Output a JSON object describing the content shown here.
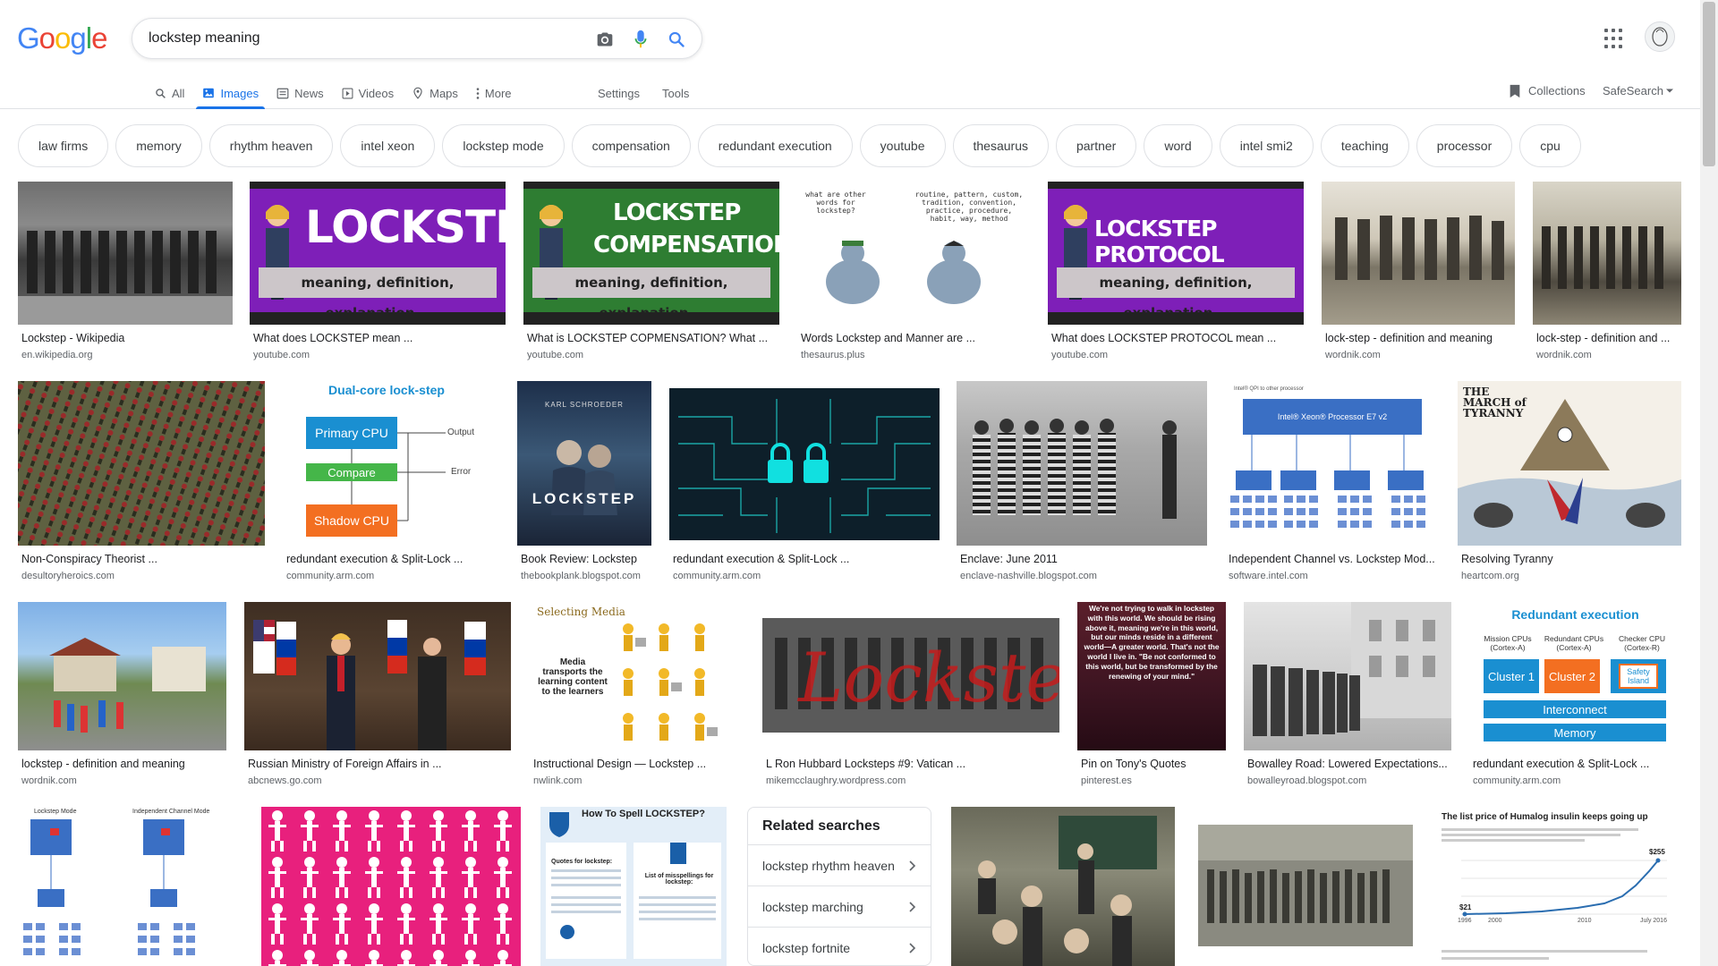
{
  "logo": {
    "letters": [
      "G",
      "o",
      "o",
      "g",
      "l",
      "e"
    ],
    "colors": [
      "#4285F4",
      "#EA4335",
      "#FBBC05",
      "#4285F4",
      "#34A853",
      "#EA4335"
    ]
  },
  "search": {
    "value": "lockstep meaning"
  },
  "tabs": [
    {
      "label": "All",
      "icon": "search-icon"
    },
    {
      "label": "Images",
      "icon": "image-icon",
      "active": true
    },
    {
      "label": "News",
      "icon": "news-icon"
    },
    {
      "label": "Videos",
      "icon": "video-icon"
    },
    {
      "label": "Maps",
      "icon": "map-pin-icon"
    },
    {
      "label": "More",
      "icon": "more-vert-icon"
    }
  ],
  "tools": {
    "settings": "Settings",
    "tools": "Tools",
    "collections": "Collections",
    "safesearch": "SafeSearch"
  },
  "chips": [
    "law firms",
    "memory",
    "rhythm heaven",
    "intel xeon",
    "lockstep mode",
    "compensation",
    "redundant execution",
    "youtube",
    "thesaurus",
    "partner",
    "word",
    "intel smi2",
    "teaching",
    "processor",
    "cpu"
  ],
  "results": [
    {
      "caption": "Lockstep - Wikipedia",
      "source": "en.wikipedia.org"
    },
    {
      "caption": "What does LOCKSTEP mean ...",
      "source": "youtube.com",
      "banner": "LOCKSTEP",
      "sub": "meaning, definition, explanation..."
    },
    {
      "caption": "What is LOCKSTEP COPMENSATION? What ...",
      "source": "youtube.com",
      "banner": "LOCKSTEP",
      "banner2": "COMPENSATION",
      "sub": "meaning, definition, explanation..."
    },
    {
      "caption": "Words Lockstep and Manner are ...",
      "source": "thesaurus.plus",
      "text_left": "what are other words for lockstep?",
      "text_right": "routine, pattern, custom, tradition, convention, practice, procedure, habit, way, method"
    },
    {
      "caption": "What does LOCKSTEP PROTOCOL mean ...",
      "source": "youtube.com",
      "banner": "LOCKSTEP PROTOCOL",
      "sub": "meaning, definition, explanation..."
    },
    {
      "caption": "lock-step - definition and meaning",
      "source": "wordnik.com"
    },
    {
      "caption": "lock-step - definition and ...",
      "source": "wordnik.com"
    },
    {
      "caption": "Non-Conspiracy Theorist ...",
      "source": "desultoryheroics.com"
    },
    {
      "caption": "redundant execution & Split-Lock ...",
      "source": "community.arm.com",
      "diagram_title": "Dual-core lock-step",
      "boxes": [
        "Primary CPU",
        "Compare",
        "Shadow CPU"
      ],
      "labels": [
        "Output",
        "Error"
      ]
    },
    {
      "caption": "Book Review: Lockstep",
      "source": "thebookplank.blogspot.com",
      "author": "KARL SCHROEDER",
      "book_title": "LOCKSTEP"
    },
    {
      "caption": "redundant execution & Split-Lock ...",
      "source": "community.arm.com"
    },
    {
      "caption": "Enclave: June 2011",
      "source": "enclave-nashville.blogspot.com"
    },
    {
      "caption": "Independent Channel vs. Lockstep Mod...",
      "source": "software.intel.com",
      "chip_label": "Intel® Xeon® Processor E7 v2"
    },
    {
      "caption": "Resolving Tyranny",
      "source": "heartcom.org",
      "cartoon_title": "THE MARCH of TYRANNY"
    },
    {
      "caption": "lockstep - definition and meaning",
      "source": "wordnik.com"
    },
    {
      "caption": "Russian Ministry of Foreign Affairs in ...",
      "source": "abcnews.go.com"
    },
    {
      "caption": "Instructional Design — Lockstep ...",
      "source": "nwlink.com",
      "media_title": "Selecting Media",
      "media_text": "Media transports the learning content to the learners"
    },
    {
      "caption": "L Ron Hubbard Locksteps #9: Vatican ...",
      "source": "mikemcclaughry.wordpress.com",
      "overlay": "Lockstep"
    },
    {
      "caption": "Pin on Tony's Quotes",
      "source": "pinterest.es",
      "quote": "We're not trying to walk in lockstep with this world. We should be rising above it, meaning we're in this world, but our minds reside in a different world—A greater world. That's not the world I live in. \"Be not conformed to this world, but be transformed by the renewing of your mind.\""
    },
    {
      "caption": "Bowalley Road: Lowered Expectations...",
      "source": "bowalleyroad.blogspot.com"
    },
    {
      "caption": "redundant execution & Split-Lock ...",
      "source": "community.arm.com",
      "diagram_title": "Redundant execution",
      "boxes": [
        "Cluster 1",
        "Cluster 2",
        "Safety Island",
        "Interconnect",
        "Memory"
      ],
      "labels": [
        "Mission CPUs (Cortex-A)",
        "Redundant CPUs (Cortex-A)",
        "Checker CPU (Cortex-R)"
      ]
    },
    {
      "caption": "",
      "source": "",
      "mode_labels": [
        "Lockstep Mode",
        "Independent Channel Mode"
      ]
    },
    {
      "caption": "",
      "source": ""
    },
    {
      "caption": "",
      "source": "",
      "spell_title": "How To Spell LOCKSTEP?",
      "spell_items": [
        "Quotes for lockstep:",
        "List of misspellings for lockstep:"
      ]
    },
    {
      "caption": "",
      "source": ""
    },
    {
      "caption": "",
      "source": ""
    },
    {
      "caption": "",
      "source": "",
      "chart_title": "The list price of Humalog insulin keeps going up",
      "chart_labels": [
        "$21",
        "$255",
        "1996",
        "2000",
        "2010",
        "July 2016"
      ]
    }
  ],
  "related": {
    "title": "Related searches",
    "items": [
      "lockstep rhythm heaven",
      "lockstep marching",
      "lockstep fortnite"
    ]
  }
}
